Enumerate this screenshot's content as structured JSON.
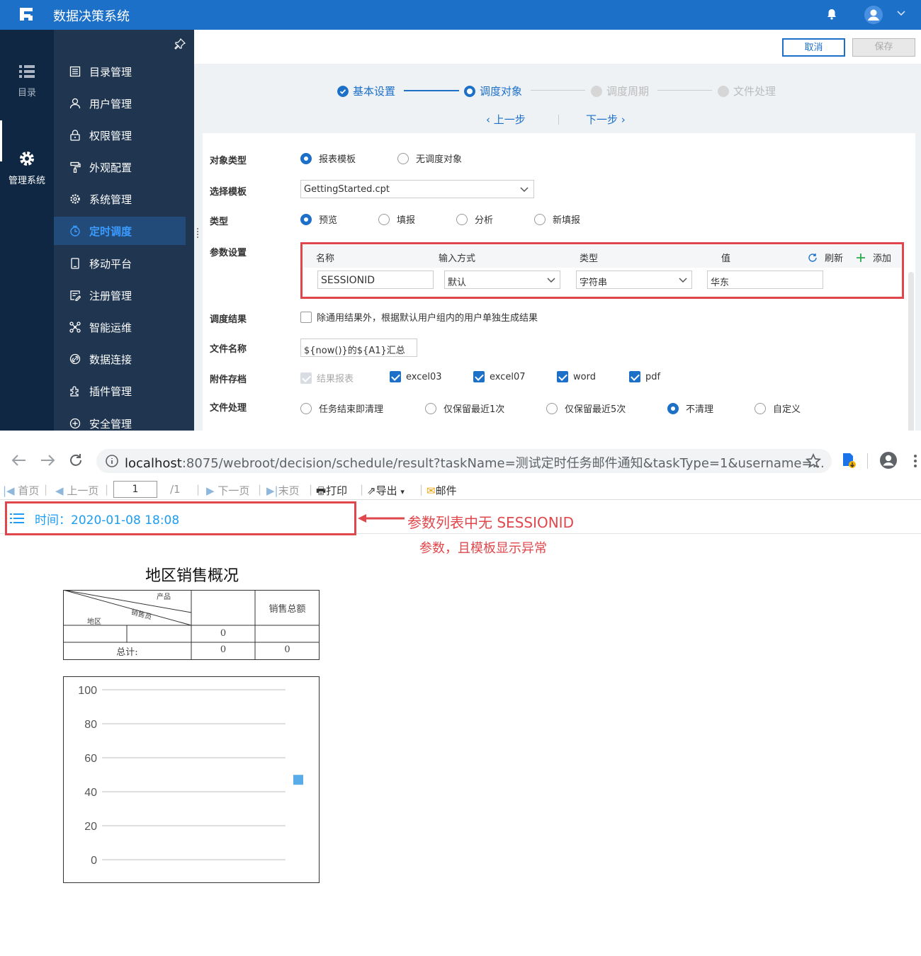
{
  "app": {
    "title": "数据决策系统"
  },
  "rail": [
    {
      "label": "目录",
      "icon": "list-icon"
    },
    {
      "label": "管理系统",
      "icon": "gear-icon"
    }
  ],
  "menu": [
    {
      "label": "目录管理",
      "icon": "catalog-icon"
    },
    {
      "label": "用户管理",
      "icon": "user-icon"
    },
    {
      "label": "权限管理",
      "icon": "lock-icon"
    },
    {
      "label": "外观配置",
      "icon": "paint-roller-icon"
    },
    {
      "label": "系统管理",
      "icon": "settings-icon"
    },
    {
      "label": "定时调度",
      "icon": "clock-icon"
    },
    {
      "label": "移动平台",
      "icon": "mobile-icon"
    },
    {
      "label": "注册管理",
      "icon": "register-icon"
    },
    {
      "label": "智能运维",
      "icon": "ops-icon"
    },
    {
      "label": "数据连接",
      "icon": "link-icon"
    },
    {
      "label": "插件管理",
      "icon": "plugin-icon"
    },
    {
      "label": "安全管理",
      "icon": "shield-icon"
    }
  ],
  "actions": {
    "cancel": "取消",
    "save": "保存"
  },
  "steps": [
    "基本设置",
    "调度对象",
    "调度周期",
    "文件处理"
  ],
  "stepnav": {
    "prev": "上一步",
    "next": "下一步"
  },
  "form": {
    "object_type": {
      "label": "对象类型",
      "options": [
        "报表模板",
        "无调度对象"
      ]
    },
    "template": {
      "label": "选择模板",
      "value": "GettingStarted.cpt"
    },
    "type": {
      "label": "类型",
      "options": [
        "预览",
        "填报",
        "分析",
        "新填报"
      ]
    },
    "params": {
      "label": "参数设置",
      "headers": [
        "名称",
        "输入方式",
        "类型",
        "值"
      ],
      "refresh": "刷新",
      "add": "添加",
      "row": {
        "name": "SESSIONID",
        "input": "默认",
        "type": "字符串",
        "value": "华东"
      }
    },
    "result": {
      "label": "调度结果",
      "text": "除通用结果外，根据默认用户组内的用户单独生成结果"
    },
    "filename": {
      "label": "文件名称",
      "value": "${now()}的${A1}汇总"
    },
    "attach": {
      "label": "附件存档",
      "options": [
        "结果报表",
        "excel03",
        "excel07",
        "word",
        "pdf"
      ]
    },
    "fileproc": {
      "label": "文件处理",
      "options": [
        "任务结束即清理",
        "仅保留最近1次",
        "仅保留最近5次",
        "不清理",
        "自定义"
      ]
    }
  },
  "browser": {
    "url_host": "localhost",
    "url_rest": ":8075/webroot/decision/schedule/result?taskName=测试定时任务邮件通知&taskType=1&username=..."
  },
  "report_toolbar": {
    "first": "首页",
    "prev": "上一页",
    "page": "1",
    "total": "/1",
    "next": "下一页",
    "last": "末页",
    "print": "打印",
    "export": "导出",
    "mail": "邮件"
  },
  "param_bar": {
    "time": "时间：2020-01-08 18:08"
  },
  "annotation": {
    "line1": "参数列表中无 SESSIONID",
    "line2": "参数，且模板显示异常"
  },
  "report": {
    "title": "地区销售概况",
    "header_product": "产品",
    "header_seller": "销售员",
    "header_region": "地区",
    "header_total": "销售总额",
    "row1_value": "0",
    "total_label": "总计:",
    "total_value1": "0",
    "total_value2": "0"
  },
  "chart_data": {
    "type": "scatter",
    "yticks": [
      "100",
      "80",
      "60",
      "40",
      "20",
      "0"
    ],
    "ylim": [
      0,
      100
    ],
    "points": [
      {
        "y": 47
      }
    ],
    "color": "#5aace8"
  }
}
